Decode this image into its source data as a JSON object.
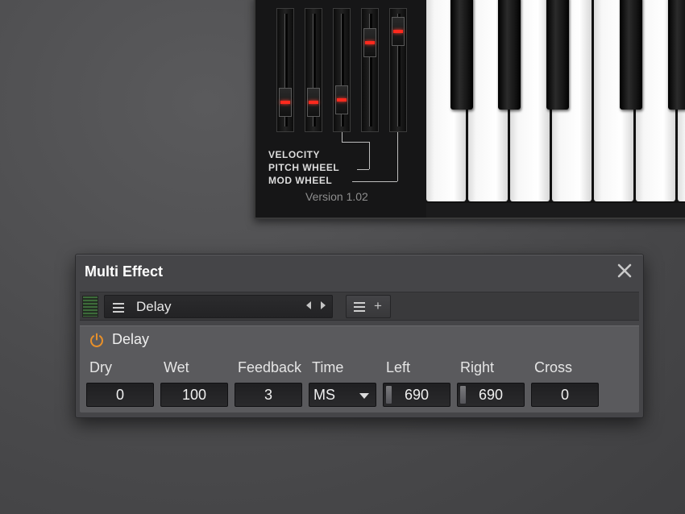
{
  "synth": {
    "labels": {
      "velocity": "VELOCITY",
      "pitch_wheel": "PITCH WHEEL",
      "mod_wheel": "MOD WHEEL"
    },
    "version": "Version 1.02"
  },
  "fx": {
    "title": "Multi Effect",
    "close_icon": "close-icon",
    "preset": {
      "name": "Delay",
      "menu_icon": "hamburger-icon",
      "prev_icon": "arrow-left-icon",
      "next_icon": "arrow-right-icon",
      "add_label": "+"
    },
    "device": {
      "name": "Delay",
      "power_icon": "power-icon",
      "power_color": "#e8902a"
    },
    "params": {
      "dry": {
        "label": "Dry",
        "value": "0"
      },
      "wet": {
        "label": "Wet",
        "value": "100"
      },
      "feedback": {
        "label": "Feedback",
        "value": "3"
      },
      "time": {
        "label": "Time",
        "value": "MS"
      },
      "left": {
        "label": "Left",
        "value": "690"
      },
      "right": {
        "label": "Right",
        "value": "690"
      },
      "cross": {
        "label": "Cross",
        "value": "0"
      }
    }
  }
}
